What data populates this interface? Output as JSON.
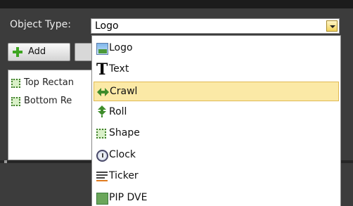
{
  "object_type": {
    "label": "Object Type:",
    "selected_value": "Logo"
  },
  "toolbar": {
    "add_label": "Add"
  },
  "object_list": {
    "items": [
      {
        "label": "Top Rectan"
      },
      {
        "label": "Bottom Re"
      }
    ]
  },
  "dropdown": {
    "items": [
      {
        "label": "Logo",
        "icon": "logo-icon"
      },
      {
        "label": "Text",
        "icon": "text-icon"
      },
      {
        "label": "Crawl",
        "icon": "crawl-icon",
        "highlighted": true
      },
      {
        "label": "Roll",
        "icon": "roll-icon"
      },
      {
        "label": "Shape",
        "icon": "shape-icon"
      },
      {
        "label": "Clock",
        "icon": "clock-icon"
      },
      {
        "label": "Ticker",
        "icon": "ticker-icon"
      },
      {
        "label": "PIP DVE",
        "icon": "pip-icon"
      }
    ],
    "text_icon_glyph": "T"
  },
  "colors": {
    "highlight": "#fbe9a6",
    "panel": "#3c3c3c",
    "accent_green": "#3ea521"
  }
}
